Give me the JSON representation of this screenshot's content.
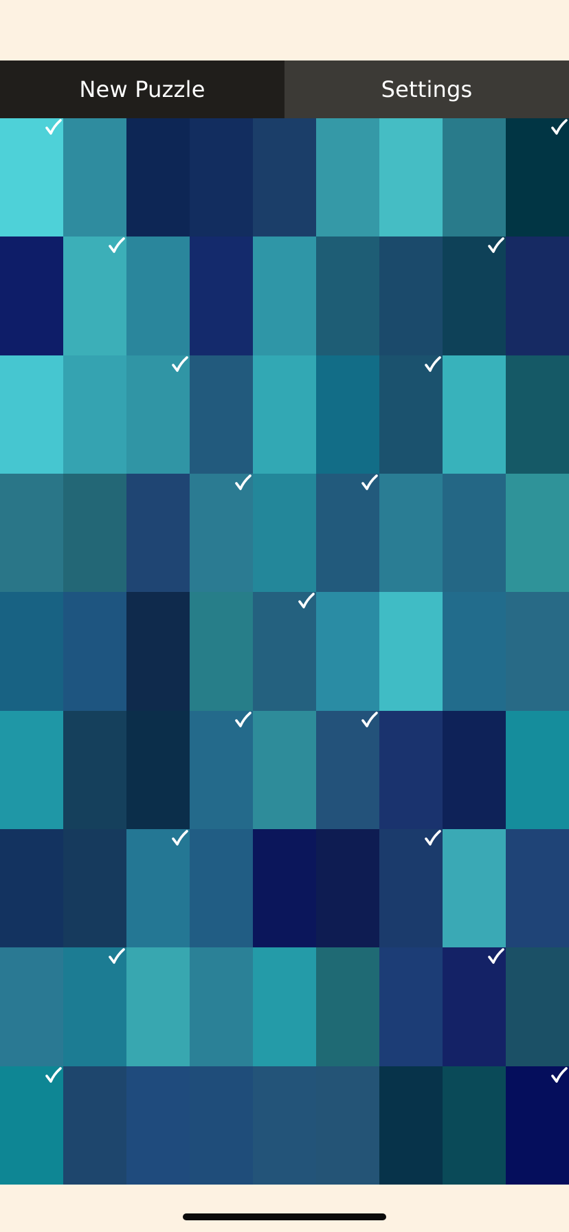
{
  "toolbar": {
    "new_puzzle_label": "New Puzzle",
    "settings_label": "Settings"
  },
  "board": {
    "columns": 9,
    "rows": 9,
    "check_color": "#ffffff",
    "tiles": [
      {
        "color": "#4ed1d8",
        "locked": true
      },
      {
        "color": "#2f8c9f",
        "locked": false
      },
      {
        "color": "#0d2655",
        "locked": false
      },
      {
        "color": "#122d5f",
        "locked": false
      },
      {
        "color": "#1b3e69",
        "locked": false
      },
      {
        "color": "#3599a7",
        "locked": false
      },
      {
        "color": "#45bdc4",
        "locked": false
      },
      {
        "color": "#297b8b",
        "locked": false
      },
      {
        "color": "#013544",
        "locked": true
      },
      {
        "color": "#0e1d68",
        "locked": false
      },
      {
        "color": "#3cafb8",
        "locked": true
      },
      {
        "color": "#2a869c",
        "locked": false
      },
      {
        "color": "#142a6c",
        "locked": false
      },
      {
        "color": "#2f96a7",
        "locked": false
      },
      {
        "color": "#1e5d75",
        "locked": false
      },
      {
        "color": "#1b4a6b",
        "locked": false
      },
      {
        "color": "#0e4158",
        "locked": true
      },
      {
        "color": "#162a63",
        "locked": false
      },
      {
        "color": "#46c6d0",
        "locked": false
      },
      {
        "color": "#35a3b1",
        "locked": false
      },
      {
        "color": "#3095a5",
        "locked": true
      },
      {
        "color": "#225a7d",
        "locked": false
      },
      {
        "color": "#32a8b4",
        "locked": false
      },
      {
        "color": "#126d87",
        "locked": false
      },
      {
        "color": "#1b526e",
        "locked": true
      },
      {
        "color": "#38b2bb",
        "locked": false
      },
      {
        "color": "#155966",
        "locked": false
      },
      {
        "color": "#2a7688",
        "locked": false
      },
      {
        "color": "#236776",
        "locked": false
      },
      {
        "color": "#1f4573",
        "locked": false
      },
      {
        "color": "#2b7b92",
        "locked": true
      },
      {
        "color": "#23879a",
        "locked": false
      },
      {
        "color": "#225a7c",
        "locked": true
      },
      {
        "color": "#2a7d94",
        "locked": false
      },
      {
        "color": "#246785",
        "locked": false
      },
      {
        "color": "#2f9399",
        "locked": false
      },
      {
        "color": "#186283",
        "locked": false
      },
      {
        "color": "#1e5580",
        "locked": false
      },
      {
        "color": "#0f2a4c",
        "locked": false
      },
      {
        "color": "#277e89",
        "locked": false
      },
      {
        "color": "#24617f",
        "locked": true
      },
      {
        "color": "#2a8ca4",
        "locked": false
      },
      {
        "color": "#40bcc5",
        "locked": false
      },
      {
        "color": "#226c8c",
        "locked": false
      },
      {
        "color": "#286a86",
        "locked": false
      },
      {
        "color": "#1f97a6",
        "locked": false
      },
      {
        "color": "#15405c",
        "locked": false
      },
      {
        "color": "#0b2e4a",
        "locked": false
      },
      {
        "color": "#246a8b",
        "locked": true
      },
      {
        "color": "#2e8c9a",
        "locked": false
      },
      {
        "color": "#23527a",
        "locked": true
      },
      {
        "color": "#1a336e",
        "locked": false
      },
      {
        "color": "#0e2258",
        "locked": false
      },
      {
        "color": "#158d9c",
        "locked": false
      },
      {
        "color": "#133360",
        "locked": false
      },
      {
        "color": "#163a5d",
        "locked": false
      },
      {
        "color": "#247794",
        "locked": true
      },
      {
        "color": "#215d84",
        "locked": false
      },
      {
        "color": "#0b165b",
        "locked": false
      },
      {
        "color": "#0e1c52",
        "locked": false
      },
      {
        "color": "#1b3b6c",
        "locked": true
      },
      {
        "color": "#3aa9b5",
        "locked": false
      },
      {
        "color": "#1f4477",
        "locked": false
      },
      {
        "color": "#2a7993",
        "locked": false
      },
      {
        "color": "#1c7c93",
        "locked": true
      },
      {
        "color": "#38a7b0",
        "locked": false
      },
      {
        "color": "#2b8197",
        "locked": false
      },
      {
        "color": "#249ba8",
        "locked": false
      },
      {
        "color": "#1f6a74",
        "locked": false
      },
      {
        "color": "#1c3d76",
        "locked": false
      },
      {
        "color": "#142266",
        "locked": true
      },
      {
        "color": "#1b5066",
        "locked": false
      },
      {
        "color": "#0e8694",
        "locked": true
      },
      {
        "color": "#1e466d",
        "locked": false
      },
      {
        "color": "#1f4b7d",
        "locked": false
      },
      {
        "color": "#1f4d7a",
        "locked": false
      },
      {
        "color": "#235479",
        "locked": false
      },
      {
        "color": "#245476",
        "locked": false
      },
      {
        "color": "#07334a",
        "locked": false
      },
      {
        "color": "#0a4a58",
        "locked": false
      },
      {
        "color": "#050e5c",
        "locked": true
      }
    ]
  }
}
